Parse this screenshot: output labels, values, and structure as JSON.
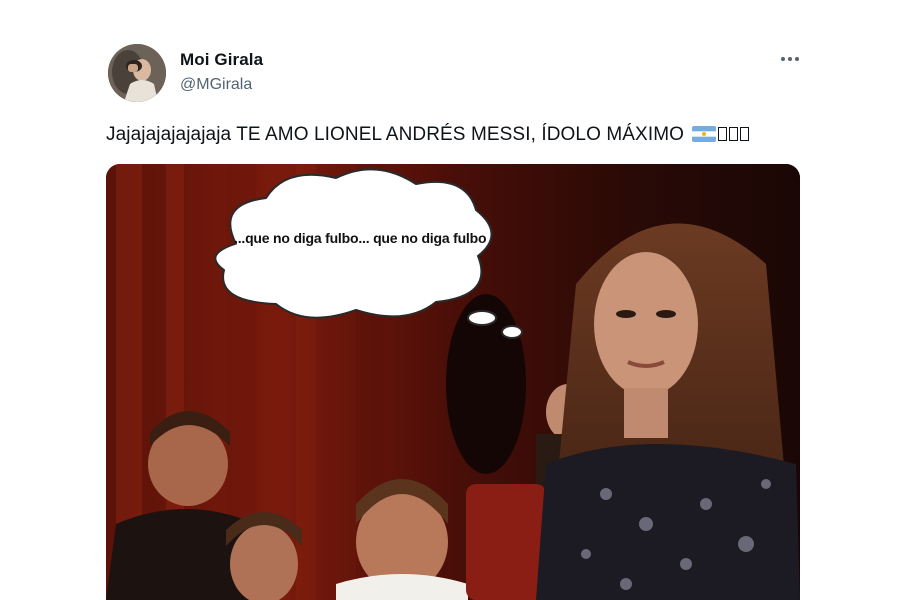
{
  "tweet": {
    "author_name": "Moi Girala",
    "author_handle": "@MGirala",
    "text": "Jajajajajajajaja TE AMO LIONEL ANDRÉS MESSI, ÍDOLO MÁXIMO",
    "more_icon": "more-horizontal-icon"
  },
  "media": {
    "thought_bubble_text": "...que no diga fulbo... que no diga fulbo"
  },
  "colors": {
    "text_primary": "#0f1419",
    "text_secondary": "#536471",
    "flag_blue": "#74acdf",
    "flag_sun": "#f6b40e"
  }
}
